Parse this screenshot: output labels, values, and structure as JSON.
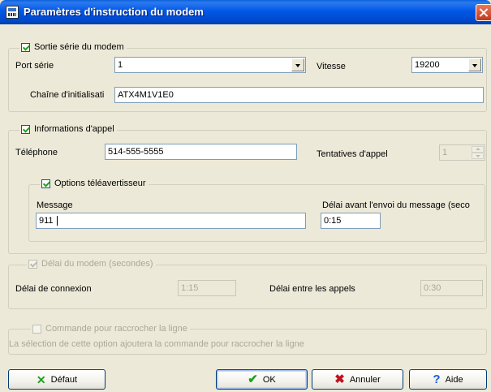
{
  "window": {
    "title": "Paramètres d'instruction du modem"
  },
  "serial_group": {
    "legend": "Sortie série du modem",
    "checked": true,
    "port_label": "Port série",
    "port_value": "1",
    "speed_label": "Vitesse",
    "speed_value": "19200",
    "init_label": "Chaîne d'initialisati",
    "init_value": "ATX4M1V1E0"
  },
  "call_group": {
    "legend": "Informations d'appel",
    "checked": true,
    "phone_label": "Téléphone",
    "phone_value": "514-555-5555",
    "attempts_label": "Tentatives d'appel",
    "attempts_value": "1"
  },
  "pager_group": {
    "legend": "Options téléavertisseur",
    "checked": true,
    "message_label": "Message",
    "message_value": "911",
    "delay_label": "Délai avant l'envoi du message (seco",
    "delay_value": "0:15"
  },
  "modem_delay_group": {
    "legend": "Délai du modem (secondes)",
    "checked": true,
    "connect_label": "Délai de connexion",
    "connect_value": "1:15",
    "between_label": "Délai entre les appels",
    "between_value": "0:30"
  },
  "hangup_group": {
    "legend": "Commande pour raccrocher la ligne",
    "checked": false,
    "note": "La sélection de cette option ajoutera la commande pour raccrocher la ligne"
  },
  "buttons": {
    "default_label": "Défaut",
    "ok_label": "OK",
    "cancel_label": "Annuler",
    "help_label": "Aide"
  },
  "icons": {
    "default": "green-x-icon",
    "ok": "green-checkmark-icon",
    "cancel": "red-x-icon",
    "help": "blue-question-icon"
  },
  "colors": {
    "titlebar": "#0058e6",
    "background": "#ece9d8",
    "check": "#21a121",
    "cancel_icon": "#c1121f",
    "help_icon": "#1d5bd8"
  }
}
